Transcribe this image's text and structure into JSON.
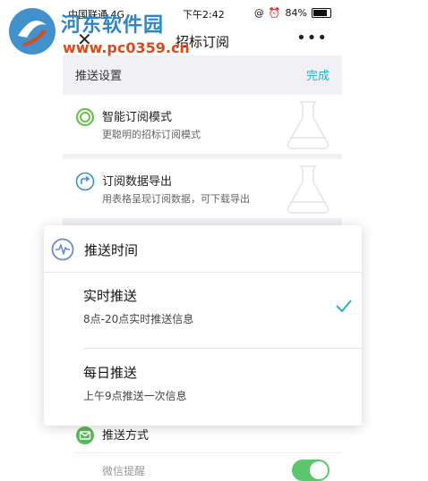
{
  "watermark": {
    "site": "河东软件园",
    "url": "www.pc0359.cn"
  },
  "status_bar": {
    "carrier": "中国联通 4G",
    "time": "下午2:42",
    "battery": "84%"
  },
  "nav": {
    "title": "招标订阅",
    "close": "✕",
    "more": "•••"
  },
  "settings_section": {
    "title": "推送设置",
    "done_label": "完成"
  },
  "cards": [
    {
      "title": "智能订阅模式",
      "desc": "更聪明的招标订阅模式"
    },
    {
      "title": "订阅数据导出",
      "desc": "用表格呈现订阅数据，可下载导出"
    }
  ],
  "popup": {
    "title": "推送时间",
    "options": [
      {
        "title": "实时推送",
        "desc": "8点-20点实时推送信息",
        "selected": true
      },
      {
        "title": "每日推送",
        "desc": "上午9点推送一次信息",
        "selected": false
      }
    ]
  },
  "push_method": {
    "title": "推送方式",
    "partial_label": "微信提醒",
    "toggle_on": true
  },
  "colors": {
    "accent": "#1fb3c4",
    "watermark_blue": "#2e85c7",
    "watermark_red": "#d64c1d",
    "toggle": "#5cc66e"
  },
  "icons": {
    "smart": "green-ring-icon",
    "export": "share-circle-icon",
    "popup": "pulse-circle-icon",
    "push_method": "mail-icon",
    "check": "checkmark-icon"
  }
}
